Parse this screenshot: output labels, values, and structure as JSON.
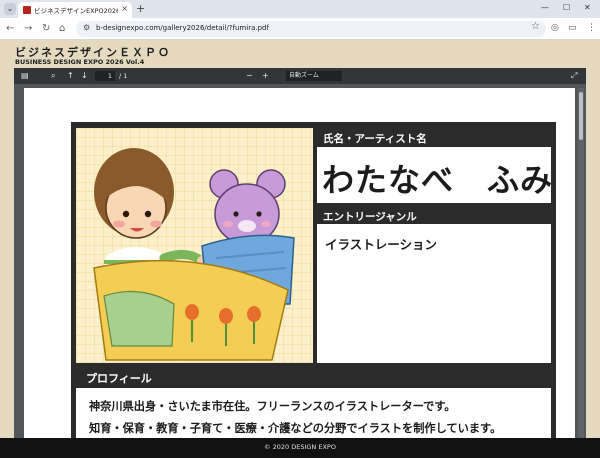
{
  "browser": {
    "tab_title": "ビジネスデザインEXPO2026 Vol.4",
    "tab_close": "×",
    "new_tab": "+",
    "tab_dropdown": "⌄",
    "url": "b-designexpo.com/gallery2026/detail/?fumira.pdf",
    "window_controls": [
      "—",
      "☐",
      "✕"
    ],
    "nav_back": "←",
    "nav_forward": "→",
    "nav_reload": "↻",
    "nav_home": "⌂"
  },
  "header": {
    "title": "ビジネスデザインＥＸＰＯ",
    "subtitle": "BUSINESS DESIGN EXPO 2026 Vol.4"
  },
  "pdf_viewer": {
    "page_current": "1",
    "page_total": "/ 1",
    "zoom_minus": "−",
    "zoom_plus": "+",
    "zoom_label": "自動ズーム"
  },
  "entry": {
    "name_heading": "氏名・アーティスト名",
    "name": "わたなべ　ふみ",
    "genre_heading": "エントリージャンル",
    "genre": "イラストレーション",
    "profile_heading": "プロフィール",
    "profile_lines": [
      "神奈川県出身・さいたま市在住。フリーランスのイラストレーターです。",
      "知育・保育・教育・子育て・医療・介護などの分野でイラストを制作しています。"
    ]
  },
  "footer": {
    "copyright": "© 2020 DESIGN EXPO"
  },
  "colors": {
    "page_bg": "#e5d9bf",
    "card_dark": "#2b2b2b",
    "pdf_toolbar": "#323639",
    "footer_bg": "#111111"
  }
}
